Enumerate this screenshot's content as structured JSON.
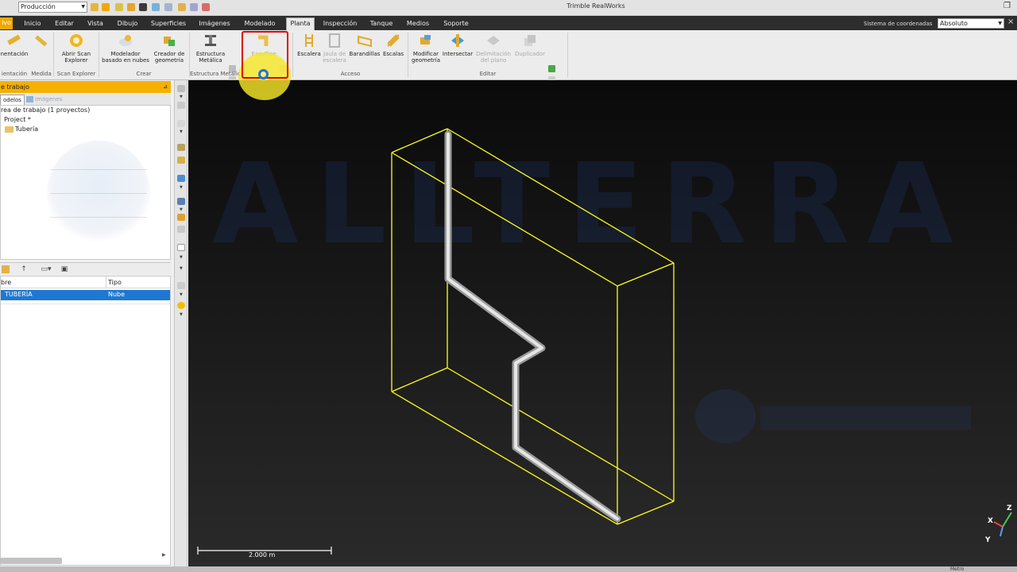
{
  "titlebar": {
    "mode_select": "Producción",
    "app_title": "Trimble RealWorks",
    "restore_icon": "❐"
  },
  "menu": {
    "tabs": [
      {
        "label": "ivo"
      },
      {
        "label": "Inicio"
      },
      {
        "label": "Editar"
      },
      {
        "label": "Vista"
      },
      {
        "label": "Dibujo"
      },
      {
        "label": "Superficies"
      },
      {
        "label": "Imágenes"
      },
      {
        "label": "Modelado"
      },
      {
        "label": "Planta"
      },
      {
        "label": "Inspección"
      },
      {
        "label": "Tanque"
      },
      {
        "label": "Medios"
      },
      {
        "label": "Soporte"
      }
    ],
    "active_tab": "Planta",
    "coord_label": "Sistema de coordenadas",
    "coord_value": "Absoluto",
    "close_icon": "×"
  },
  "ribbon": {
    "buttons": [
      {
        "label": "nentación",
        "state": "enabled"
      },
      {
        "label": "Abrir Scan Explorer",
        "state": "enabled"
      },
      {
        "label": "Modelador basado en nubes",
        "state": "enabled"
      },
      {
        "label": "Creador de geometría",
        "state": "enabled"
      },
      {
        "label": "Estructura Metálica",
        "state": "enabled"
      },
      {
        "label": "EasyPipe",
        "state": "disabled"
      },
      {
        "label": "Escalera",
        "state": "enabled"
      },
      {
        "label": "Jaula de escalera",
        "state": "disabled"
      },
      {
        "label": "Barandillas",
        "state": "enabled"
      },
      {
        "label": "Escalas",
        "state": "enabled"
      },
      {
        "label": "Modificar geometría",
        "state": "enabled"
      },
      {
        "label": "Intersectar",
        "state": "enabled"
      },
      {
        "label": "Delimitación del plano",
        "state": "disabled"
      },
      {
        "label": "Duplicador",
        "state": "disabled"
      }
    ],
    "groups": [
      {
        "label": "ientación"
      },
      {
        "label": "Medida"
      },
      {
        "label": "Scan Explorer"
      },
      {
        "label": "Crear"
      },
      {
        "label": "Estructura Metálic"
      },
      {
        "label": "Acceso"
      },
      {
        "label": "Editar"
      }
    ]
  },
  "workspace": {
    "title": "e trabajo",
    "pin_icon": "⊿",
    "tabs": [
      {
        "label": "odelos"
      },
      {
        "label": "Imágenes"
      }
    ],
    "tree": [
      {
        "label": "rea de trabajo (1 proyectos)"
      },
      {
        "label": "Project  *"
      },
      {
        "label": "Tubería"
      }
    ]
  },
  "list": {
    "columns": [
      "bre",
      "Tipo"
    ],
    "rows": [
      {
        "name": "TUBERÍA",
        "type": "Nube"
      }
    ],
    "toolbar_icons": [
      "folder-icon",
      "up-arrow-icon",
      "view-options-icon",
      "properties-icon"
    ]
  },
  "viewport": {
    "watermark": "ALLTERRA",
    "scale_label": "2.000 m",
    "axes": {
      "z": "Z",
      "x": "X",
      "y": "Y"
    }
  },
  "colors": {
    "accent_orange": "#f0a800",
    "selection_blue": "#1d78d4",
    "highlight_red": "#e20000",
    "cursor_yellow": "#f5e628",
    "bbox_yellow": "#ffff1a"
  },
  "statusbar": {
    "text": "Metro"
  }
}
